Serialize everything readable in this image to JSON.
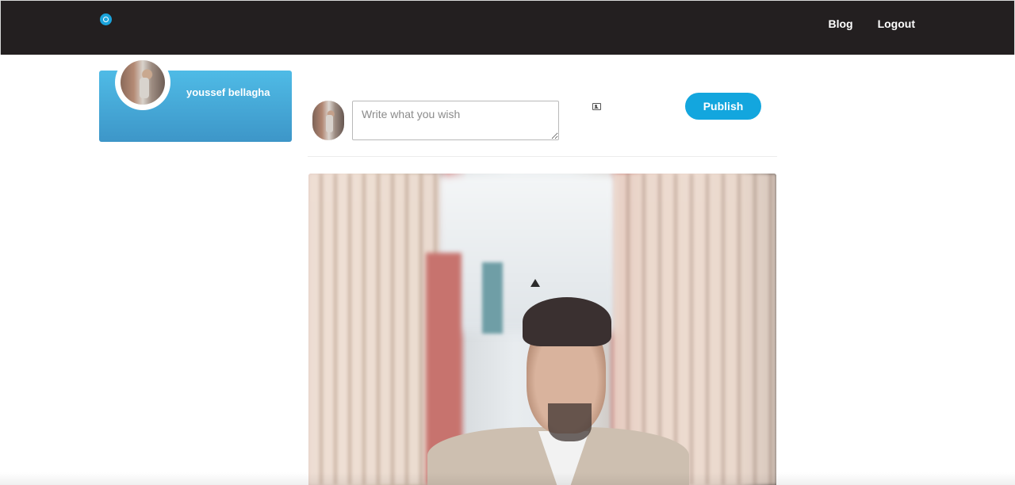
{
  "navbar": {
    "logo_icon": "brand-logo-icon",
    "links": [
      {
        "label": "Blog"
      },
      {
        "label": "Logout"
      }
    ],
    "background_color": "#231f20"
  },
  "profile": {
    "name": "youssef bellagha",
    "card_color": "#4fbbe6"
  },
  "composer": {
    "placeholder": "Write what you wish",
    "value": "",
    "attach_icon": "image-icon",
    "publish_label": "Publish",
    "publish_color": "#13a6de"
  },
  "feed": {
    "posts": [
      {
        "image_description_icon": "post-photo"
      }
    ]
  }
}
